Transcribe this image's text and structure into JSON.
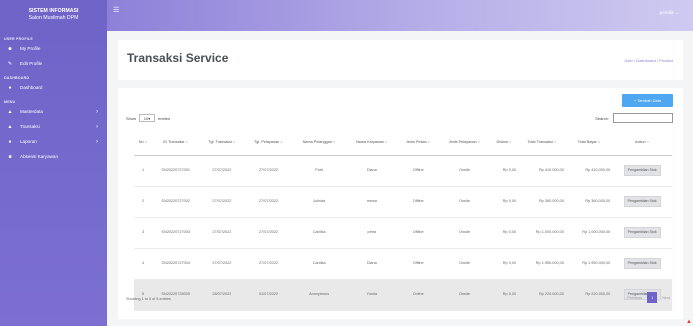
{
  "brand": {
    "line1": "SISTEM INFORMASI",
    "line2": "Salon Muslimah DPM"
  },
  "sidebar": {
    "sections": {
      "profile": "USER PROFILE",
      "dashboard": "DASHBOARD",
      "menu": "MENU"
    },
    "items": [
      {
        "label": "My Profile",
        "icon": "user-icon"
      },
      {
        "label": "Edit Profile",
        "icon": "user-edit-icon"
      },
      {
        "label": "Dashboard",
        "icon": "dashboard-icon"
      },
      {
        "label": "Masterdata",
        "icon": "database-icon"
      },
      {
        "label": "Transaksi",
        "icon": "transaction-icon"
      },
      {
        "label": "Laporan",
        "icon": "report-icon"
      },
      {
        "label": "Absensi Karyawan",
        "icon": "attendance-icon"
      }
    ]
  },
  "topbar": {
    "user": "pemilik"
  },
  "page": {
    "title": "Transaksi Service",
    "breadcrumb": "User / Dashboard / Product"
  },
  "toolbar": {
    "add_button": "+ Tambah Data",
    "show_label": "Show",
    "show_value": "10",
    "entries_label": "entries",
    "search_label": "Search:"
  },
  "table": {
    "headers": [
      "No",
      "ID Transaksi",
      "Tgl. Transaksi",
      "Tgl. Pelayanan",
      "Nama Pelanggan",
      "Nama Karyawan",
      "Jenis Pesan",
      "Jenis Pelayanan",
      "Diskon",
      "Total Transaksi",
      "Total Bayar",
      "Action"
    ],
    "rows": [
      {
        "no": "1",
        "id": "SN20220727001",
        "tgl_transaksi": "27/07/2022",
        "tgl_pelayanan": "27/07/2022",
        "pelanggan": "Putri",
        "karyawan": "Diana",
        "pesan": "Offline",
        "pelayanan": "Onsite",
        "diskon": "Rp 0,00",
        "total": "Rp 410.000,00",
        "bayar": "Rp 410.000,00",
        "action": "Pengambilan Stok"
      },
      {
        "no": "2",
        "id": "SN20220727002",
        "tgl_transaksi": "27/07/2022",
        "tgl_pelayanan": "27/07/2022",
        "pelanggan": "Adinda",
        "karyawan": "mewa",
        "pesan": "Offline",
        "pelayanan": "Onsite",
        "diskon": "Rp 0,00",
        "total": "Rp 360.000,00",
        "bayar": "Rp 360.000,00",
        "action": "Pengambilan Stok"
      },
      {
        "no": "3",
        "id": "SN20220727003",
        "tgl_transaksi": "27/07/2022",
        "tgl_pelayanan": "27/07/2022",
        "pelanggan": "Cantika",
        "karyawan": "petra",
        "pesan": "Offline",
        "pelayanan": "Onsite",
        "diskon": "Rp 0,00",
        "total": "Rp 1.000.000,00",
        "bayar": "Rp 1.000.000,00",
        "action": "Pengambilan Stok"
      },
      {
        "no": "4",
        "id": "SN20220727004",
        "tgl_transaksi": "27/07/2022",
        "tgl_pelayanan": "27/07/2022",
        "pelanggan": "Cantika",
        "karyawan": "Diana",
        "pesan": "Offline",
        "pelayanan": "Onsite",
        "diskon": "Rp 0,00",
        "total": "Rp 1.950.000,00",
        "bayar": "Rp 1.950.000,00",
        "action": "Pengambilan Stok"
      },
      {
        "no": "5",
        "id": "SN20220728005",
        "tgl_transaksi": "28/07/2022",
        "tgl_pelayanan": "01/07/2022",
        "pelanggan": "Anonymous",
        "karyawan": "Yunita",
        "pesan": "Online",
        "pelayanan": "Onsite",
        "diskon": "Rp 0,00",
        "total": "Rp 220.000,00",
        "bayar": "Rp 220.000,00",
        "action": "Pengambilan Stok"
      }
    ]
  },
  "footer": {
    "info": "Showing 1 to 5 of 5 entries",
    "previous": "Previous",
    "page": "1",
    "next": "Next"
  },
  "colors": {
    "sidebar": "#6f63c8",
    "accent": "#4ea7f0",
    "page_active": "#6f63c8"
  }
}
